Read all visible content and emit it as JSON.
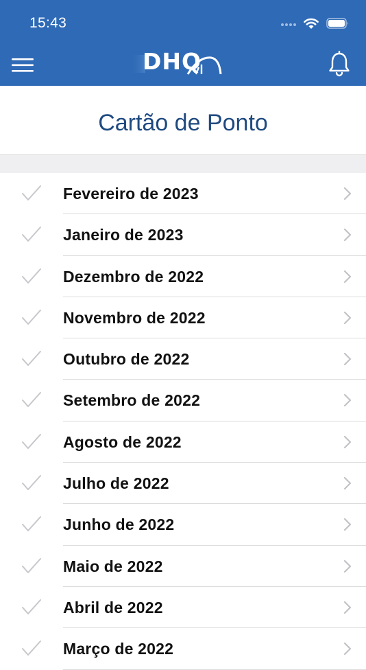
{
  "status_bar": {
    "time": "15:43"
  },
  "header": {
    "logo_text": "DHQ",
    "menu_icon": "hamburger-icon",
    "notification_icon": "bell-icon",
    "background_color": "#2f6ab6"
  },
  "page": {
    "title": "Cartão de Ponto",
    "title_color": "#1f4a80"
  },
  "months": [
    {
      "label": "Fevereiro de 2023"
    },
    {
      "label": "Janeiro de 2023"
    },
    {
      "label": "Dezembro de 2022"
    },
    {
      "label": "Novembro de 2022"
    },
    {
      "label": "Outubro de 2022"
    },
    {
      "label": "Setembro de 2022"
    },
    {
      "label": "Agosto de 2022"
    },
    {
      "label": "Julho de 2022"
    },
    {
      "label": "Junho de 2022"
    },
    {
      "label": "Maio de 2022"
    },
    {
      "label": "Abril de 2022"
    },
    {
      "label": "Março de 2022"
    }
  ]
}
